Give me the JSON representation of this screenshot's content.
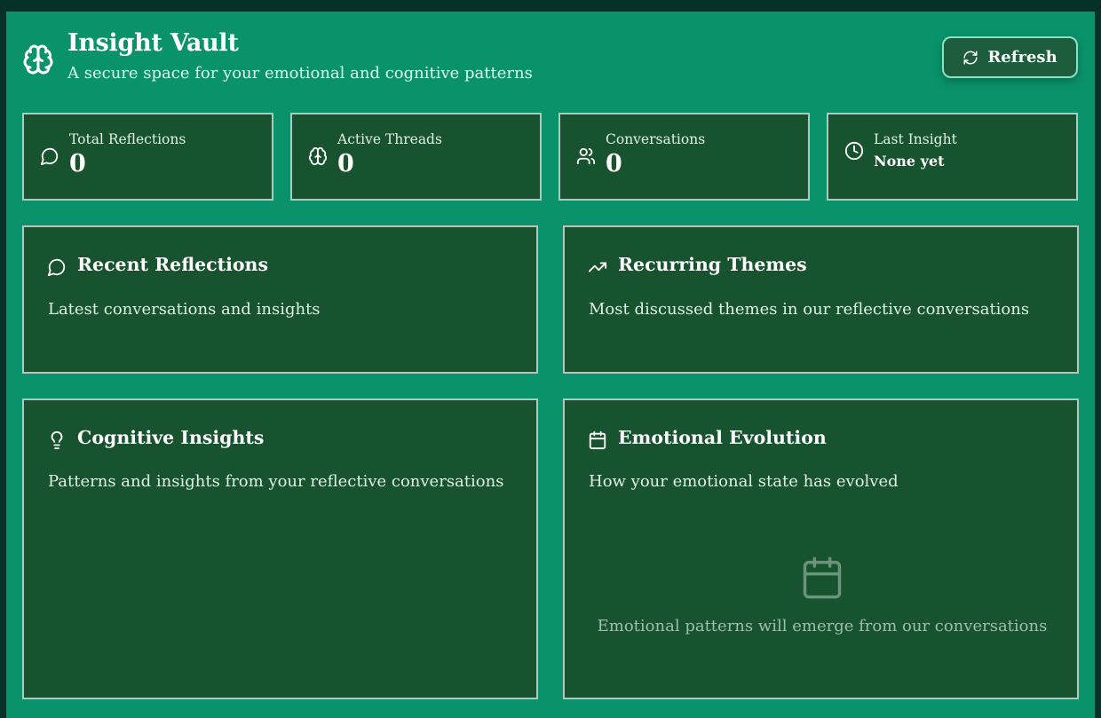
{
  "header": {
    "title": "Insight Vault",
    "subtitle": "A secure space for your emotional and cognitive patterns",
    "refresh_label": "Refresh"
  },
  "stats": [
    {
      "label": "Total Reflections",
      "value": "0",
      "icon": "message-circle-icon"
    },
    {
      "label": "Active Threads",
      "value": "0",
      "icon": "brain-icon"
    },
    {
      "label": "Conversations",
      "value": "0",
      "icon": "users-icon"
    },
    {
      "label": "Last Insight",
      "value": "None yet",
      "icon": "clock-icon"
    }
  ],
  "panels": {
    "recent": {
      "title": "Recent Reflections",
      "desc": "Latest conversations and insights",
      "icon": "message-circle-icon"
    },
    "themes": {
      "title": "Recurring Themes",
      "desc": "Most discussed themes in our reflective conversations",
      "icon": "trending-up-icon"
    },
    "cognitive": {
      "title": "Cognitive Insights",
      "desc": "Patterns and insights from your reflective conversations",
      "icon": "lightbulb-icon"
    },
    "emotional": {
      "title": "Emotional Evolution",
      "desc": "How your emotional state has evolved",
      "icon": "calendar-icon",
      "empty_text": "Emotional patterns will emerge from our conversations"
    }
  },
  "colors": {
    "background": "#0a936a",
    "card": "#17532f",
    "card_border": "#b5c7bc",
    "outer": "#06302a"
  }
}
